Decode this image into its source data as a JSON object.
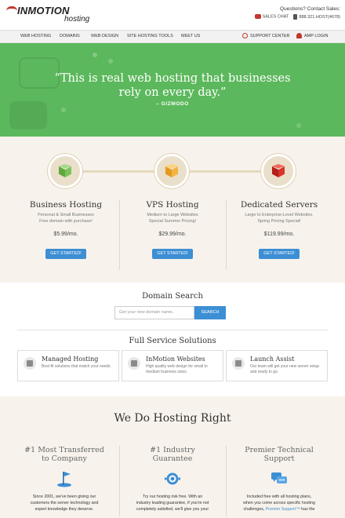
{
  "header": {
    "logo_main": "INMOTION",
    "logo_sub": "hosting",
    "contact_title": "Questions? Contact Sales:",
    "sales_chat": "SALES CHAT",
    "phone": "888.321.HOST(4678)"
  },
  "nav": {
    "items": [
      "WEB HOSTING",
      "DOMAINS",
      "WEB DESIGN",
      "SITE HOSTING TOOLS",
      "MEET US"
    ],
    "support": "SUPPORT CENTER",
    "login": "AMP LOGIN"
  },
  "hero": {
    "quote": "“This is real web hosting that businesses rely on every day.”",
    "source": "– GIZMODO"
  },
  "plans": [
    {
      "title": "Business Hosting",
      "desc1": "Personal & Small Businesses",
      "desc2": "Free domain with purchase!",
      "price": "$5.99/mo.",
      "button": "GET STARTED!",
      "color": "green"
    },
    {
      "title": "VPS Hosting",
      "desc1": "Medium to Large Websites",
      "desc2": "Special Summer Pricing!",
      "price": "$29.99/mo.",
      "button": "GET STARTED!",
      "color": "orange"
    },
    {
      "title": "Dedicated Servers",
      "desc1": "Large to Enterprise-Level Websites.",
      "desc2": "Spring Pricing Special!",
      "price": "$119.99/mo.",
      "button": "GET STARTED!",
      "color": "red"
    }
  ],
  "domain": {
    "title": "Domain Search",
    "placeholder": "Get your new domain name..",
    "button": "SEARCH"
  },
  "full_service": {
    "title": "Full Service Solutions",
    "cards": [
      {
        "name": "Managed Hosting",
        "desc": "Best-fit solutions that match your needs."
      },
      {
        "name": "InMotion Websites",
        "desc": "High quality web design for small to medium business sizes."
      },
      {
        "name": "Launch Assist",
        "desc": "Our team will get your new server setup and ready to go."
      }
    ]
  },
  "right": {
    "title": "We Do Hosting Right",
    "features": [
      {
        "title1": "#1 Most Transferred",
        "title2": "to Company",
        "text1": "Since 2001, we've been giving our",
        "text2": "customers the server technology and",
        "text3": "expert knowledge they deserve."
      },
      {
        "title1": "#1 Industry",
        "title2": "Guarantee",
        "text1": "Try our hosting risk free. With an",
        "text2": "industry leading guarantee, if you're not",
        "text3": "completely satisfied, we'll give you your"
      },
      {
        "title1": "Premier Technical",
        "title2": "Support",
        "text1": "Included free with all hosting plans,",
        "text2": "when you come across specific hosting",
        "text3_pre": "challenges, ",
        "text3_link": "Premier Support™",
        "text3_post": " has the"
      }
    ]
  },
  "colors": {
    "hero_green": "#5cb85c",
    "button_blue": "#3d8fd4",
    "brand_red": "#c0392b"
  }
}
